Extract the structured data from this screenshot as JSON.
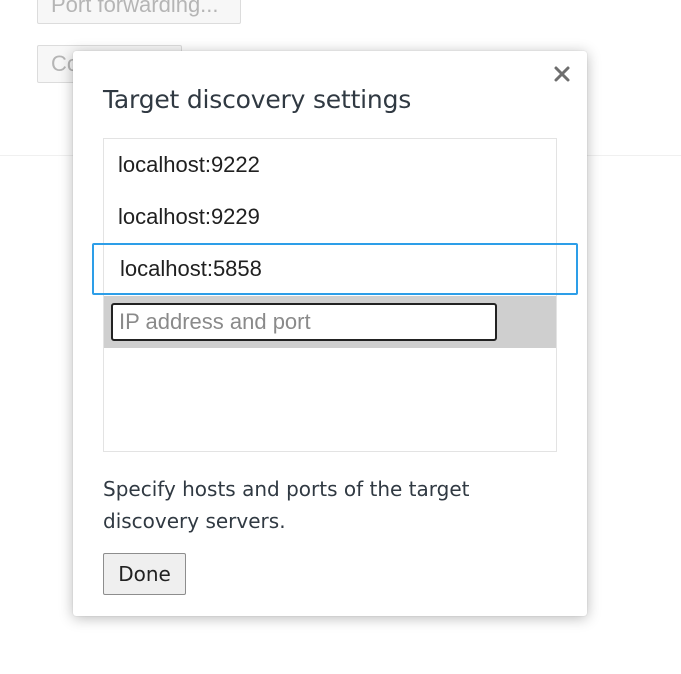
{
  "background": {
    "port_forwarding_label": "Port forwarding...",
    "configure_label": "Configure..."
  },
  "dialog": {
    "title": "Target discovery settings",
    "close_icon": "close-icon",
    "targets": [
      {
        "label": "localhost:9222",
        "selected": false
      },
      {
        "label": "localhost:9229",
        "selected": false
      },
      {
        "label": "localhost:5858",
        "selected": true
      }
    ],
    "input": {
      "value": "",
      "placeholder": "IP address and port"
    },
    "help_text": "Specify hosts and ports of the target discovery servers.",
    "done_label": "Done"
  },
  "colors": {
    "selection_border": "#2d9ee8",
    "input_row_bg": "#cfcfcf",
    "title_text": "#303942"
  }
}
